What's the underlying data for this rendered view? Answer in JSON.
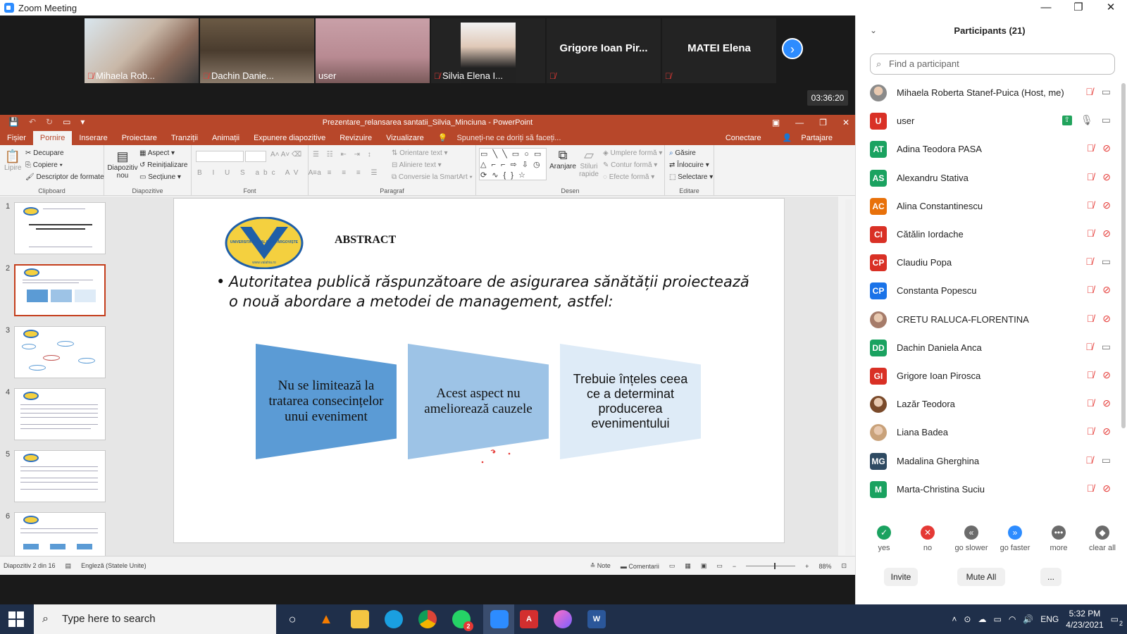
{
  "zoom": {
    "window_title": "Zoom Meeting",
    "timer": "03:36:20",
    "tiles": [
      {
        "name": "Mihaela Rob...",
        "muted": true
      },
      {
        "name": "Dachin Danie...",
        "muted": true
      },
      {
        "name": "user",
        "muted": false
      },
      {
        "name": "Silvia Elena I...",
        "muted": true
      },
      {
        "big_name": "Grigore Ioan Pir...",
        "muted": true
      },
      {
        "big_name": "MATEI Elena",
        "muted": true
      }
    ]
  },
  "ppt": {
    "title": "Prezentare_relansarea santatii_Silvia_Minciuna - PowerPoint",
    "tabs": [
      "Fișier",
      "Pornire",
      "Inserare",
      "Proiectare",
      "Tranziții",
      "Animații",
      "Expunere diapozitive",
      "Revizuire",
      "Vizualizare"
    ],
    "tell_me": "Spuneți-ne ce doriți să faceți...",
    "connect": "Conectare",
    "share": "Partajare",
    "ribbon": {
      "paste": "Lipire",
      "cut": "Decupare",
      "copy": "Copiere",
      "format_painter": "Descriptor de formate",
      "clipboard_label": "Clipboard",
      "new_slide": "Diapozitiv nou",
      "layout": "Aspect",
      "reset": "Reinițializare",
      "section": "Secțiune",
      "slides_label": "Diapozitive",
      "font_label": "Font",
      "text_direction": "Orientare text",
      "align_text": "Aliniere text",
      "smartart": "Conversie la SmartArt",
      "paragraph_label": "Paragraf",
      "arrange": "Aranjare",
      "quick_styles": "Stiluri rapide",
      "shape_fill": "Umplere formă",
      "shape_outline": "Contur formă",
      "shape_effects": "Efecte formă",
      "drawing_label": "Desen",
      "find": "Găsire",
      "replace": "Înlocuire",
      "select": "Selectare",
      "editing_label": "Editare"
    },
    "slide_numbers": [
      "1",
      "2",
      "3",
      "4",
      "5",
      "6"
    ],
    "slide": {
      "heading": "ABSTRACT",
      "logo_text": "UNIVERSITATEA VALAHIA TÂRGOVIȘTE",
      "logo_url": "www.valahia.ro",
      "bullet": "Autoritatea  publică răspunzătoare de asigurarea sănătății proiectează o nouă abordare a metodei de management, astfel:",
      "box1": "Nu se limitează la tratarea consecințelor unui eveniment",
      "box2": "Acest aspect nu ameliorează cauzele",
      "box3": "Trebuie înțeles ceea ce a determinat producerea evenimentului"
    },
    "status": {
      "slide_info": "Diapozitiv 2 din 16",
      "language": "Engleză (Statele Unite)",
      "notes": "Note",
      "comments": "Comentarii",
      "zoom": "88%"
    }
  },
  "participants": {
    "header": "Participants (21)",
    "search_placeholder": "Find a participant",
    "list": [
      {
        "name": "Mihaela Roberta Stanef-Puica (Host, me)",
        "initials": "",
        "color": "#8a8a8a",
        "mic": "off",
        "cam": "on",
        "photo": true
      },
      {
        "name": "user",
        "initials": "U",
        "color": "#d93025",
        "mic": "on",
        "cam": "on",
        "share": true
      },
      {
        "name": "Adina Teodora PASA",
        "initials": "AT",
        "color": "#1aa260",
        "mic": "off",
        "cam": "off"
      },
      {
        "name": "Alexandru Stativa",
        "initials": "AS",
        "color": "#1aa260",
        "mic": "off",
        "cam": "off"
      },
      {
        "name": "Alina Constantinescu",
        "initials": "AC",
        "color": "#e8710a",
        "mic": "off",
        "cam": "off"
      },
      {
        "name": "Cătălin Iordache",
        "initials": "CI",
        "color": "#d93025",
        "mic": "off",
        "cam": "off"
      },
      {
        "name": "Claudiu Popa",
        "initials": "CP",
        "color": "#d93025",
        "mic": "off",
        "cam": "on"
      },
      {
        "name": "Constanta Popescu",
        "initials": "CP",
        "color": "#1a73e8",
        "mic": "off",
        "cam": "off"
      },
      {
        "name": "CRETU RALUCA-FLORENTINA",
        "initials": "",
        "color": "#a67c6a",
        "mic": "off",
        "cam": "off",
        "photo": true
      },
      {
        "name": "Dachin Daniela Anca",
        "initials": "DD",
        "color": "#1aa260",
        "mic": "off",
        "cam": "on"
      },
      {
        "name": "Grigore Ioan Pirosca",
        "initials": "GI",
        "color": "#d93025",
        "mic": "off",
        "cam": "off"
      },
      {
        "name": "Lazăr Teodora",
        "initials": "",
        "color": "#7a4a2a",
        "mic": "off",
        "cam": "off",
        "photo": true
      },
      {
        "name": "Liana Badea",
        "initials": "",
        "color": "#c9a27a",
        "mic": "off",
        "cam": "off",
        "photo": true
      },
      {
        "name": "Madalina Gherghina",
        "initials": "MG",
        "color": "#2e4a62",
        "mic": "off",
        "cam": "on"
      },
      {
        "name": "Marta-Christina Suciu",
        "initials": "M",
        "color": "#1aa260",
        "mic": "off",
        "cam": "off"
      }
    ],
    "reactions": [
      {
        "label": "yes",
        "color": "#1aa260",
        "glyph": "✓"
      },
      {
        "label": "no",
        "color": "#e53935",
        "glyph": "✕"
      },
      {
        "label": "go slower",
        "color": "#6b6b6b",
        "glyph": "«"
      },
      {
        "label": "go faster",
        "color": "#2d8cff",
        "glyph": "»"
      },
      {
        "label": "more",
        "color": "#6b6b6b",
        "glyph": "•••"
      },
      {
        "label": "clear all",
        "color": "#6b6b6b",
        "glyph": "◆"
      }
    ],
    "invite": "Invite",
    "mute_all": "Mute All",
    "more_btn": "..."
  },
  "taskbar": {
    "search_placeholder": "Type here to search",
    "lang": "ENG",
    "time": "5:32 PM",
    "date": "4/23/2021",
    "whatsapp_badge": "2",
    "notif_badge": "2"
  }
}
